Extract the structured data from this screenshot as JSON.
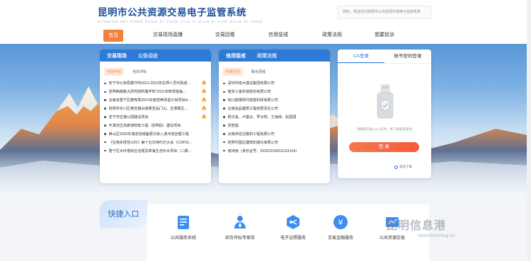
{
  "header": {
    "title": "昆明市公共资源交易电子监管系统",
    "subtitle": "KUNMING SHI GONG GONG ZI YUAN JIAO YI DIAN ZI JIAN GUAN XI TONG",
    "welcome": "您好，欢迎访问昆明市公共资源交易电子监管系统"
  },
  "nav": [
    {
      "label": "首页",
      "active": true
    },
    {
      "label": "交易现场直播"
    },
    {
      "label": "交易回看"
    },
    {
      "label": "信用惩戒"
    },
    {
      "label": "政策法规"
    },
    {
      "label": "我要投诉"
    }
  ],
  "left_panel": {
    "tabs": [
      "交易现场",
      "公告动态"
    ],
    "sub_tabs": [
      "当日开标",
      "当日评标"
    ],
    "items": [
      {
        "text": "安宁市公安局看守所2021-2023年在押人员代购成…",
        "hot": true
      },
      {
        "text": "昆明西南联大研究院附属学校“2021年新增遮盖…",
        "hot": true
      },
      {
        "text": "云南省晋宁区教育局2021年度营养改善计划项目H…",
        "hot": true
      },
      {
        "text": "昆明市东川区黄龙镇白家箐至翁门山、龙潭箐区…",
        "hot": true
      },
      {
        "text": "安宁市空港公园建设项目",
        "hot": true
      },
      {
        "text": "环滇池生态廊道修复工程（昆明段）建设项目",
        "hot": false
      },
      {
        "text": "西山区2020年滇池流域面源污染入滇河流治理工程",
        "hot": false
      },
      {
        "text": "《生物多样性公约》第十五次缔约方大会（COP15…",
        "hot": false
      },
      {
        "text": "晋宁区水环境综合治理及草海生态补水项目（二期…",
        "hot": false
      }
    ]
  },
  "credit_panel": {
    "tabs": [
      "信用惩戒",
      "政策法规"
    ],
    "sub_tabs": [
      "不良行为",
      "联合惩戒"
    ],
    "items": [
      "深圳市億大建设集团有限公司",
      "南京三金科技股份有限公司",
      "四川航搏现代智能科技有限公司",
      "云南尚品建筑工程有限责任公司",
      "杨文良、卢基云、罗冰燕、王海琪、赵国强",
      "张智超",
      "云南昂信达路桥工程有限公司",
      "昆明中国达建筑机械化有限公司",
      "谢诗雨（身份证号：332623199511151416）"
    ]
  },
  "login": {
    "tabs": [
      "CA登录",
      "账号密码登录"
    ],
    "hint": "请确保已插入CA证书，并下载安装驱动",
    "button": "登 录",
    "driver": "驱动下载"
  },
  "quick": {
    "label": "快捷入口",
    "items": [
      {
        "label": "公共服务系统",
        "icon": "service-icon"
      },
      {
        "label": "综合评标专家库",
        "icon": "expert-icon"
      },
      {
        "label": "电子证照服务",
        "icon": "license-icon"
      },
      {
        "label": "交易金融服务",
        "icon": "finance-icon"
      },
      {
        "label": "公共资源交易",
        "icon": "trade-icon"
      }
    ]
  },
  "watermark": {
    "cn": "昆明信息港",
    "en": "www.kunming.cn"
  },
  "colors": {
    "primary": "#2f7ad6",
    "accent": "#f57e3b",
    "title": "#1d4f9a",
    "hot": "#e5462b"
  }
}
